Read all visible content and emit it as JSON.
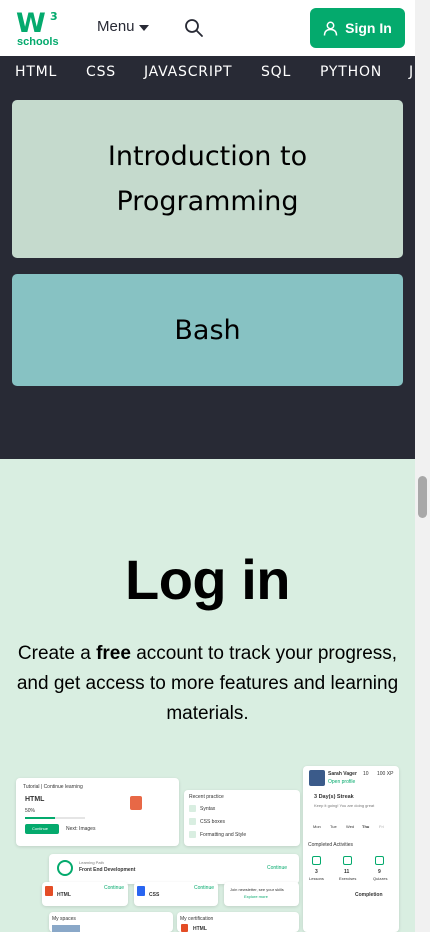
{
  "header": {
    "logo_text": "schools",
    "menu_label": "Menu",
    "signin_label": "Sign In"
  },
  "topnav": {
    "items": [
      "HTML",
      "CSS",
      "JAVASCRIPT",
      "SQL",
      "PYTHON",
      "J"
    ]
  },
  "cards": [
    {
      "title": "Introduction to Programming"
    },
    {
      "title": "Bash"
    }
  ],
  "login": {
    "title": "Log in",
    "desc_pre": "Create a ",
    "desc_bold": "free",
    "desc_post": " account to track your progress, and get access to more features and learning materials."
  },
  "preview": {
    "tutorial_crumb": "Tutorial | Continue learning",
    "course_name": "HTML",
    "course_progress": "50%",
    "continue_label": "Continue",
    "next_label": "Next: Images",
    "recent_header": "Recent practice",
    "recent_items": [
      "Syntax",
      "CSS boxes",
      "Formatting and Style"
    ],
    "learning_path_label": "Learning Path",
    "learning_path_name": "Front End Development",
    "learning_path_action": "Continue",
    "mini_courses": [
      "HTML",
      "CSS"
    ],
    "mini_action": "Continue",
    "explore_text": "Join newsletter, see your skills",
    "explore_link": "Explore more",
    "my_spaces": "My spaces",
    "my_certification": "My certification",
    "cert_name": "HTML",
    "profile_name": "Sarah Vager",
    "profile_link": "Open profile",
    "profile_level": "10",
    "profile_xp": "100 XP",
    "streak_label": "3 Day(s) Streak",
    "streak_sub": "Keep it going! You are doing great",
    "days": [
      "Mon",
      "Tue",
      "Wed",
      "Thu",
      "Fri"
    ],
    "completed_header": "Completed Activities",
    "stats": [
      {
        "value": "3",
        "label": "Lessons"
      },
      {
        "value": "11",
        "label": "Exercises"
      },
      {
        "value": "9",
        "label": "Quizzes"
      }
    ],
    "completion_label": "Completion"
  },
  "colors": {
    "brand_green": "#04aa6d",
    "dark_bg": "#282a35",
    "card_intro": "#c5dacd",
    "card_bash": "#87c2c3",
    "login_bg": "#d9eee1"
  }
}
